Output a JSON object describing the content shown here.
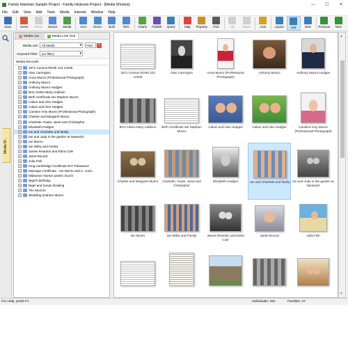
{
  "window": {
    "title": "Family Historian Sample Project - Family Historian Project - [Media Window]",
    "min": "—",
    "max": "☐",
    "close": "✕"
  },
  "menu": [
    "File",
    "Edit",
    "View",
    "Add",
    "Tools",
    "Media",
    "Internet",
    "Window",
    "Help"
  ],
  "toolbar": [
    {
      "label": "Save",
      "icon": "save-icon",
      "color": "#3b6fb6"
    },
    {
      "label": "Home",
      "icon": "home-icon",
      "color": "#d25b3d"
    },
    {
      "label": "Focus",
      "icon": "focus-icon",
      "color": "#8a8a8a",
      "disabled": true
    },
    {
      "label": "Source",
      "icon": "source-icon",
      "color": "#5b8bd1"
    },
    {
      "label": "Media",
      "icon": "media-icon",
      "color": "#4f9c4a"
    },
    {
      "label": "Ancs",
      "icon": "ancestors-icon",
      "color": "#4f8ac9"
    },
    {
      "label": "Descs",
      "icon": "descendants-icon",
      "color": "#4f8ac9"
    },
    {
      "label": "Both",
      "icon": "both-icon",
      "color": "#4f8ac9"
    },
    {
      "label": "Rels",
      "icon": "relatives-icon",
      "color": "#4f8ac9"
    },
    {
      "label": "Charts",
      "icon": "charts-icon",
      "color": "#5aa04d"
    },
    {
      "label": "Publish",
      "icon": "publish-icon",
      "color": "#6b4fa6"
    },
    {
      "label": "Query",
      "icon": "query-icon",
      "color": "#3b7fb6"
    },
    {
      "label": "Map",
      "icon": "map-icon",
      "color": "#d24a3a"
    },
    {
      "label": "Property",
      "icon": "property-icon",
      "color": "#c8902b"
    },
    {
      "label": "Find",
      "icon": "find-icon",
      "color": "#5a5a5a"
    },
    {
      "label": "Up",
      "icon": "up-icon",
      "color": "#8a8a8a",
      "disabled": true
    },
    {
      "label": "Down",
      "icon": "down-icon",
      "color": "#8a8a8a",
      "disabled": true
    },
    {
      "label": "Auto",
      "icon": "auto-icon",
      "color": "#d2a22b"
    },
    {
      "label": "Layout",
      "icon": "layout-icon",
      "color": "#3b7fb6"
    },
    {
      "label": "Link",
      "icon": "link-icon",
      "color": "#3b7fb6",
      "selected": true
    },
    {
      "label": "View",
      "icon": "view-icon",
      "color": "#3b7fb6"
    },
    {
      "label": "Previous",
      "icon": "previous-icon",
      "color": "#3b8f3b"
    },
    {
      "label": "Next",
      "icon": "next-icon",
      "color": "#3b8f3b"
    }
  ],
  "sidebar": {
    "tab_label": "Media W..."
  },
  "left_pane": {
    "tabs": [
      "Media List",
      "Media Link Tool"
    ],
    "media_list_label": "Media List:",
    "media_list_value": "All Media",
    "find_label": "Find",
    "keyword_label": "Keyword Filter:",
    "keyword_value": "(no filter)",
    "tree_header": "Media Records",
    "records": [
      "1871 Census RG09 123 12345",
      "Alan Carrington",
      "Anna Munro (Professional Photograph)",
      "Anthony Munro",
      "Anthony Munro Hodges",
      "BAC-Helen-Mary-Addison",
      "Birth Certificate Ian Stephen Munro",
      "Calum and Alex Hodges",
      "Calum and Alex Hodges",
      "Caroline Amy Munro (Professional Photograph)",
      "Charles and Margaret Munro",
      "Charlotte, Paula, Janet and Christopher",
      "Elizabeth Hodges",
      "Ian and Charlotte and family",
      "Ian and Judy in the garden at Nantwich",
      "Ian Munro",
      "Ian Wiley and Family",
      "James Reardon and Edna Cole",
      "Janet Record",
      "Julia Fish",
      "King Cambridge Certificate M P Pleasance",
      "Marriage Certificate - Ian Munro and C. Carri...",
      "Midsomer Norton parish church",
      "Nigel's Birthday",
      "Nigel and Susan Dowling",
      "The Munros",
      "Wedding-Graham Munro"
    ],
    "highlighted_index": 13
  },
  "gallery": [
    {
      "caption": "1871 Census RG09 123 12345",
      "kind": "doc"
    },
    {
      "caption": "Alan Carrington",
      "kind": "bw"
    },
    {
      "caption": "Anna Munro (Professional Photograph)",
      "kind": "color-child"
    },
    {
      "caption": "Anthony Munro",
      "kind": "color-man"
    },
    {
      "caption": "Anthony Munro Hodges",
      "kind": "color-suit"
    },
    {
      "caption": "BAC-Helen-Mary-Addison",
      "kind": "bw-group"
    },
    {
      "caption": "Birth Certificate Ian Stephen Munro",
      "kind": "doc"
    },
    {
      "caption": "Calum and Alex Hodges",
      "kind": "color-kids"
    },
    {
      "caption": "Calum and Alex Hodges",
      "kind": "color-kids2"
    },
    {
      "caption": "Caroline Amy Munro (Professional Photograph)",
      "kind": "color-girl"
    },
    {
      "caption": "Charles and Margaret Munro",
      "kind": "sepia"
    },
    {
      "caption": "Charlotte, Paula, Janet and Christopher",
      "kind": "color-group"
    },
    {
      "caption": "Elizabeth Hodges",
      "kind": "bw-portrait"
    },
    {
      "caption": "Ian and Charlotte and family",
      "kind": "color-family",
      "selected": true
    },
    {
      "caption": "Ian and Judy in the garden at Nantwich",
      "kind": "bw-garden"
    },
    {
      "caption": "Ian Munro",
      "kind": "bw-group2"
    },
    {
      "caption": "Ian Wiley and Family",
      "kind": "color-outdoor"
    },
    {
      "caption": "James Reardon and Edna Cole",
      "kind": "bw-couple"
    },
    {
      "caption": "Janet Record",
      "kind": "color-janet"
    },
    {
      "caption": "Julia Fish",
      "kind": "color-julia"
    },
    {
      "caption": "",
      "kind": "doc"
    },
    {
      "caption": "",
      "kind": "doc2"
    },
    {
      "caption": "",
      "kind": "church"
    },
    {
      "caption": "",
      "kind": "bw-group3"
    },
    {
      "caption": "",
      "kind": "color-party"
    }
  ],
  "status": {
    "help": "For Help, press F1",
    "individuals": "Individuals: 184",
    "families": "Families: 47"
  }
}
